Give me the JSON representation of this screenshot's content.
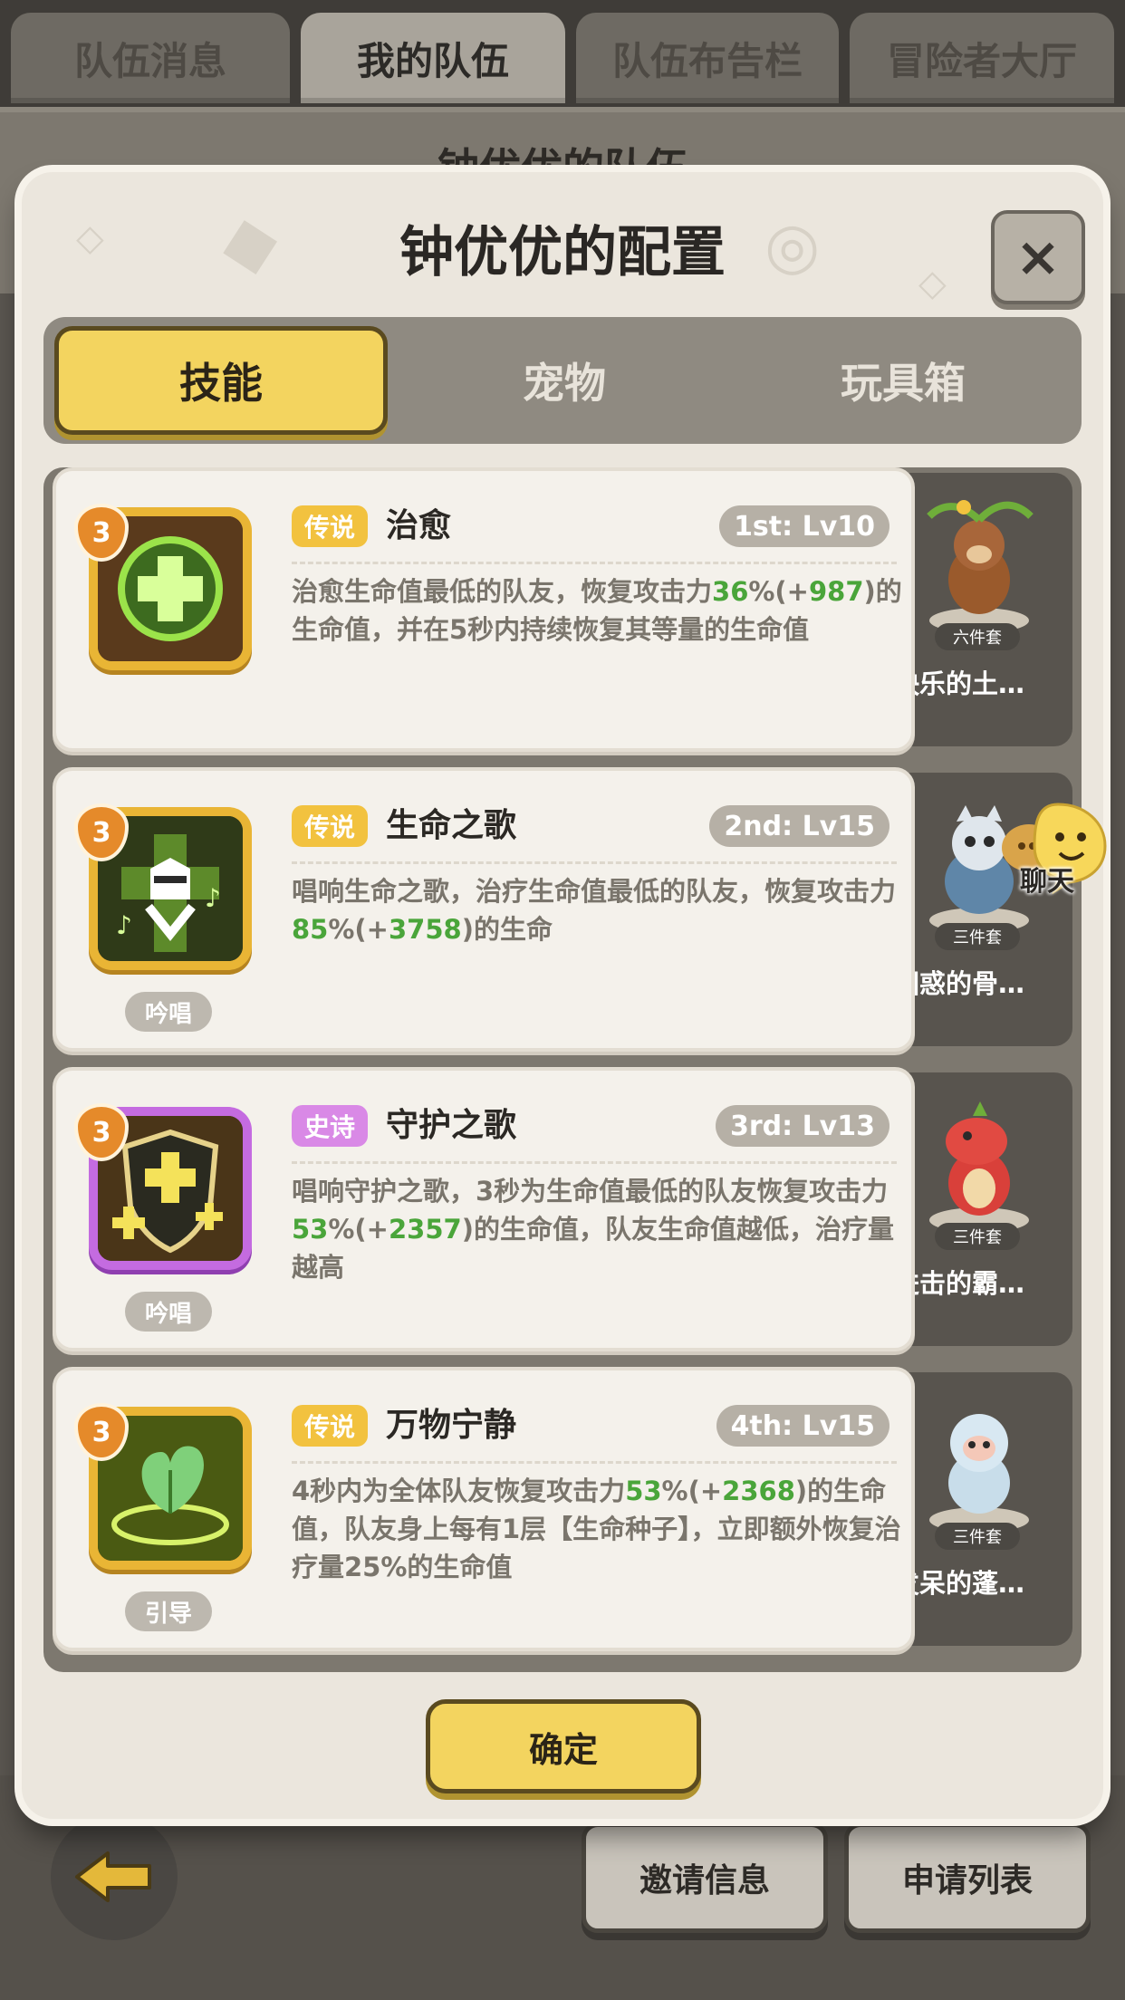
{
  "top_tabs": [
    "队伍消息",
    "我的队伍",
    "队伍布告栏",
    "冒险者大厅"
  ],
  "background": {
    "team_title": "钟优优的队伍",
    "invite_button": "邀请信息",
    "apply_button": "申请列表"
  },
  "dialog": {
    "title": "钟优优的配置",
    "close_label": "×",
    "tabs": [
      "技能",
      "宠物",
      "玩具箱"
    ],
    "confirm": "确定"
  },
  "skills": [
    {
      "level_badge": "3",
      "rarity": "传说",
      "name": "治愈",
      "slot": "1st: Lv10",
      "cast_type": "",
      "desc_a": "治愈生命值最低的队友，恢复攻击力",
      "pct": "36",
      "desc_b": "%(+",
      "bonus": "987",
      "desc_c": ")的生命值，并在5秒内持续恢复其等量的生命值"
    },
    {
      "level_badge": "3",
      "rarity": "传说",
      "name": "生命之歌",
      "slot": "2nd: Lv15",
      "cast_type": "吟唱",
      "desc_a": "唱响生命之歌，治疗生命值最低的队友，恢复攻击力",
      "pct": "85",
      "desc_b": "%(+",
      "bonus": "3758",
      "desc_c": ")的生命"
    },
    {
      "level_badge": "3",
      "rarity": "史诗",
      "name": "守护之歌",
      "slot": "3rd: Lv13",
      "cast_type": "吟唱",
      "desc_a": "唱响守护之歌，3秒为生命值最低的队友恢复攻击力",
      "pct": "53",
      "desc_b": "%(+",
      "bonus": "2357",
      "desc_c": ")的生命值，队友生命值越低，治疗量越高"
    },
    {
      "level_badge": "3",
      "rarity": "传说",
      "name": "万物宁静",
      "slot": "4th: Lv15",
      "cast_type": "引导",
      "desc_a": "4秒内为全体队友恢复攻击力",
      "pct": "53",
      "desc_b": "%(+",
      "bonus": "2368",
      "desc_c": ")的生命值，队友身上每有1层【生命种子】，立即额外恢复治疗量25%的生命值"
    }
  ],
  "pets": [
    {
      "name": "快乐的土…",
      "set": "六件套"
    },
    {
      "name": "困惑的骨…",
      "set": "三件套"
    },
    {
      "name": "进击的霸…",
      "set": "三件套"
    },
    {
      "name": "发呆的蓬…",
      "set": "三件套"
    }
  ],
  "chat": {
    "label": "聊天"
  },
  "colors": {
    "legend": "#f2c23f",
    "epic": "#d989e6",
    "bonus_green": "#4aa53a",
    "button_yellow": "#f3d45f"
  }
}
